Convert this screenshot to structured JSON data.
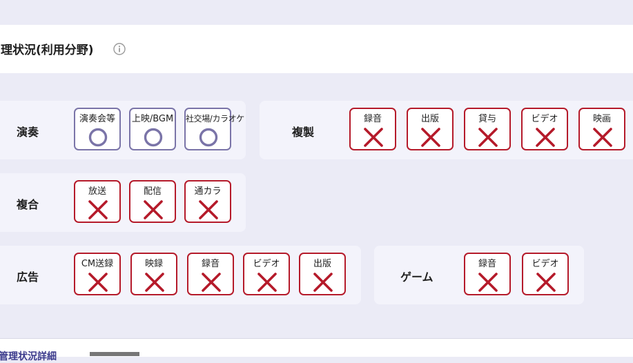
{
  "section": {
    "title": "理状況(利用分野)",
    "info_icon": "info-icon"
  },
  "groups": {
    "ensou": {
      "label": "演奏",
      "items": [
        {
          "label": "演奏会等",
          "status": "ok"
        },
        {
          "label": "上映/BGM",
          "status": "ok"
        },
        {
          "label": "社交場/カラオケ",
          "status": "ok"
        }
      ]
    },
    "fukusei": {
      "label": "複製",
      "items": [
        {
          "label": "録音",
          "status": "ng"
        },
        {
          "label": "出版",
          "status": "ng"
        },
        {
          "label": "貸与",
          "status": "ng"
        },
        {
          "label": "ビデオ",
          "status": "ng"
        },
        {
          "label": "映画",
          "status": "ng"
        }
      ]
    },
    "fukugou": {
      "label": "複合",
      "items": [
        {
          "label": "放送",
          "status": "ng"
        },
        {
          "label": "配信",
          "status": "ng"
        },
        {
          "label": "通カラ",
          "status": "ng"
        }
      ]
    },
    "koukoku": {
      "label": "広告",
      "items": [
        {
          "label": "CM送録",
          "status": "ng"
        },
        {
          "label": "映録",
          "status": "ng"
        },
        {
          "label": "録音",
          "status": "ng"
        },
        {
          "label": "ビデオ",
          "status": "ng"
        },
        {
          "label": "出版",
          "status": "ng"
        }
      ]
    },
    "game": {
      "label": "ゲーム",
      "items": [
        {
          "label": "録音",
          "status": "ng"
        },
        {
          "label": "ビデオ",
          "status": "ng"
        }
      ]
    }
  },
  "footer": {
    "link_text": "管理状況詳細"
  },
  "colors": {
    "ok": "#7a74a8",
    "ng": "#b51a2a",
    "background": "#ebebf6"
  }
}
